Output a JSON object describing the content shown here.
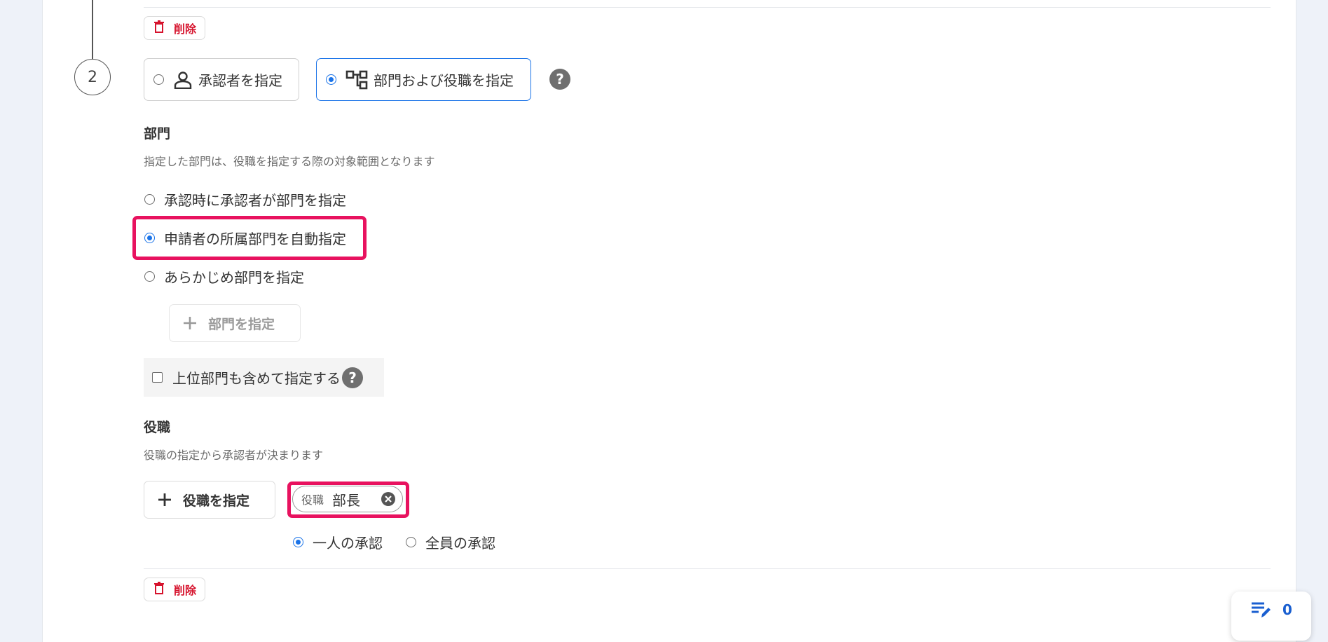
{
  "step": {
    "number": "2"
  },
  "delete_label": "削除",
  "approver_type": {
    "option_person": "承認者を指定",
    "option_department": "部門および役職を指定",
    "selected": "department"
  },
  "department": {
    "title": "部門",
    "description": "指定した部門は、役職を指定する際の対象範囲となります",
    "options": [
      {
        "label": "承認時に承認者が部門を指定",
        "selected": false
      },
      {
        "label": "申請者の所属部門を自動指定",
        "selected": true
      },
      {
        "label": "あらかじめ部門を指定",
        "selected": false
      }
    ],
    "specify_button": "部門を指定",
    "include_parent_label": "上位部門も含めて指定する",
    "include_parent_checked": false
  },
  "position": {
    "title": "役職",
    "description": "役職の指定から承認者が決まります",
    "specify_button": "役職を指定",
    "chip_tag": "役職",
    "chip_value": "部長",
    "approval_options": [
      {
        "label": "一人の承認",
        "selected": true
      },
      {
        "label": "全員の承認",
        "selected": false
      }
    ]
  },
  "fab": {
    "count": "0"
  },
  "colors": {
    "accent": "#1a73e8",
    "danger": "#d6132d",
    "highlight": "#e8125f"
  }
}
